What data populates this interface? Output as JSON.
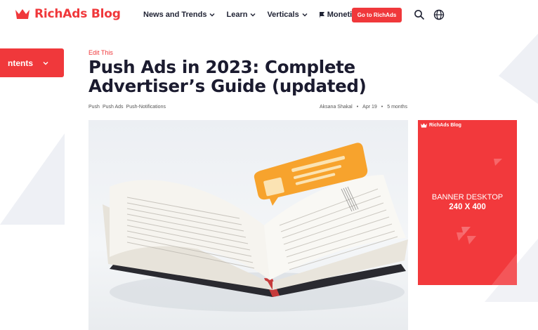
{
  "header": {
    "logo_text": "RichAds Blog",
    "nav": [
      {
        "label": "News and Trends",
        "has_dropdown": true
      },
      {
        "label": "Learn",
        "has_dropdown": true
      },
      {
        "label": "Verticals",
        "has_dropdown": true
      },
      {
        "label": "Monetize",
        "has_dropdown": false,
        "icon": "flag-icon"
      }
    ],
    "cta_label": "Go to RichAds",
    "icons": [
      "search-icon",
      "globe-icon"
    ]
  },
  "sidebar": {
    "contents_label": "ntents"
  },
  "article": {
    "edit_link": "Edit This",
    "title_line1": "Push Ads in 2023: Complete",
    "title_line2": "Advertiser’s Guide (updated)",
    "tags": [
      "Push",
      "Push Ads",
      "Push-Notifications"
    ],
    "author": "Aksana Shakal",
    "date": "Apr 19",
    "read_time": "5 months",
    "hero_image": "open-book-with-notification-illustration"
  },
  "banner": {
    "brand": "RichAds Blog",
    "line1": "BANNER DESKTOP",
    "line2": "240 X 400"
  },
  "colors": {
    "brand_red": "#f0383b",
    "title_text": "#1b1b2f",
    "notification_orange": "#f7a32d"
  }
}
